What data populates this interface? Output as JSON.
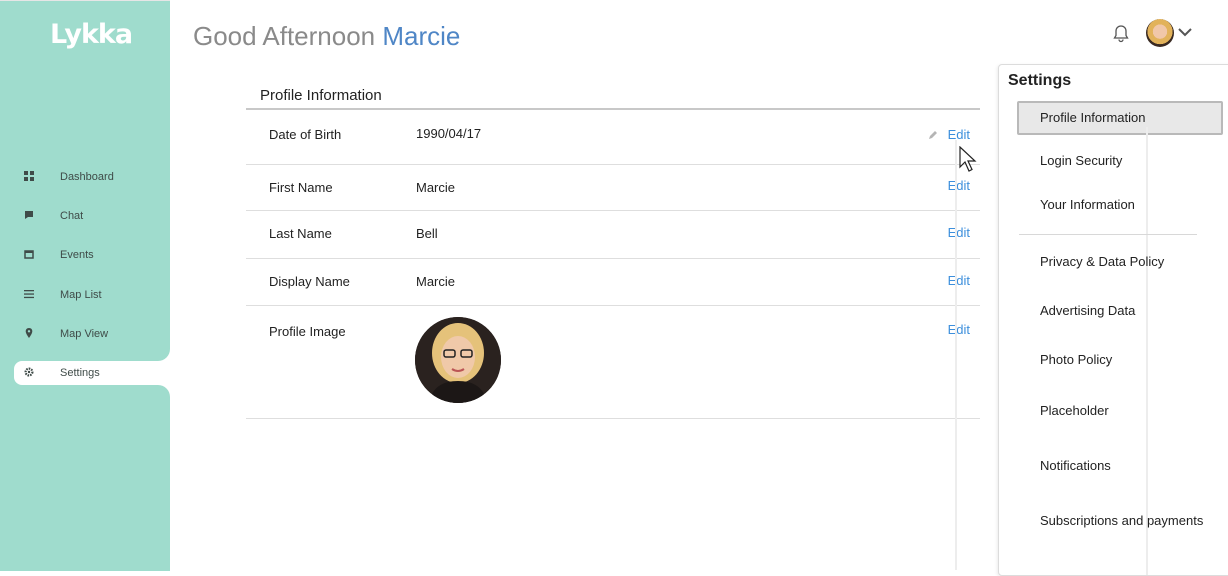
{
  "app": {
    "logo_text": "Lykka"
  },
  "sidebar": {
    "items": [
      {
        "label": "Dashboard",
        "icon": "dashboard-icon"
      },
      {
        "label": "Chat",
        "icon": "chat-icon"
      },
      {
        "label": "Events",
        "icon": "calendar-icon"
      },
      {
        "label": "Map List",
        "icon": "list-icon"
      },
      {
        "label": "Map View",
        "icon": "map-pin-icon"
      },
      {
        "label": "Settings",
        "icon": "gear-icon",
        "active": true
      }
    ]
  },
  "header": {
    "greeting": "Good Afternoon",
    "user_name": "Marcie"
  },
  "profile": {
    "section_title": "Profile Information",
    "rows": [
      {
        "label": "Date of Birth",
        "value": "1990/04/17",
        "edit": "Edit"
      },
      {
        "label": "First Name",
        "value": "Marcie",
        "edit": "Edit"
      },
      {
        "label": "Last Name",
        "value": "Bell",
        "edit": "Edit"
      },
      {
        "label": "Display Name",
        "value": "Marcie",
        "edit": "Edit"
      },
      {
        "label": "Profile Image",
        "value": "",
        "edit": "Edit"
      }
    ]
  },
  "settings": {
    "title": "Settings",
    "items": [
      "Profile Information",
      "Login Security",
      "Your Information",
      "Privacy & Data Policy",
      "Advertising Data",
      "Photo Policy",
      "Placeholder",
      "Notifications",
      "Subscriptions and payments"
    ],
    "active_index": 0
  },
  "colors": {
    "sidebar": "#9fdccd",
    "accent": "#4f86c6",
    "link": "#3d8fdc"
  }
}
